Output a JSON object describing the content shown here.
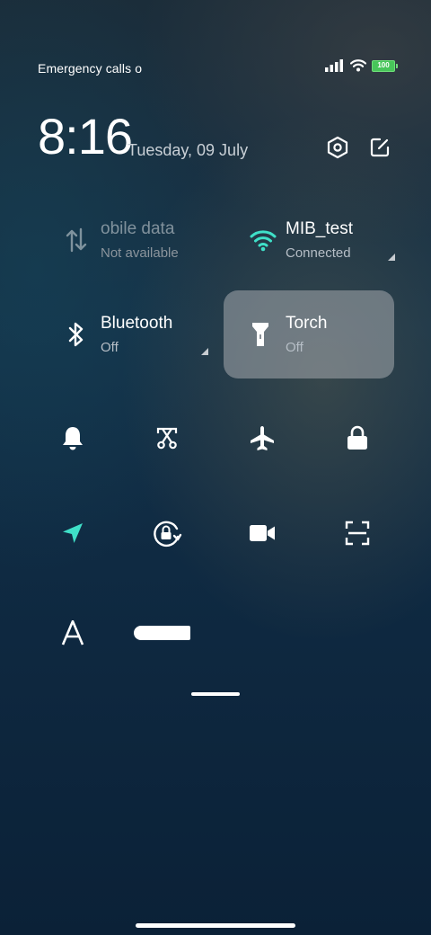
{
  "status_bar": {
    "carrier_text": "Emergency calls o",
    "battery_level": "100",
    "battery_color": "#48c55a"
  },
  "header": {
    "time": "8:16",
    "date": "Tuesday, 09 July",
    "settings_icon": "hexagon-settings-icon",
    "edit_icon": "edit-icon"
  },
  "tiles": [
    {
      "title": "obile data",
      "subtitle": "Not available",
      "icon": "mobile-data-arrows-icon",
      "active": false
    },
    {
      "title": "MIB_test",
      "subtitle": "Connected",
      "icon": "wifi-icon",
      "active": false,
      "accent": "#3fe0c8"
    },
    {
      "title": "Bluetooth",
      "subtitle": "Off",
      "icon": "bluetooth-icon",
      "active": false
    },
    {
      "title": "Torch",
      "subtitle": "Off",
      "icon": "torch-icon",
      "active": true
    }
  ],
  "quick_buttons_row1": [
    "bell-icon",
    "screenshot-scissors-icon",
    "airplane-icon",
    "lock-icon"
  ],
  "quick_buttons_row2": [
    "location-arrow-icon",
    "rotation-lock-icon",
    "video-camera-icon",
    "scanner-icon"
  ],
  "quick_buttons_row3": [
    "font-a-icon",
    "brightness-slider"
  ],
  "accent_color": "#3fe0c8"
}
